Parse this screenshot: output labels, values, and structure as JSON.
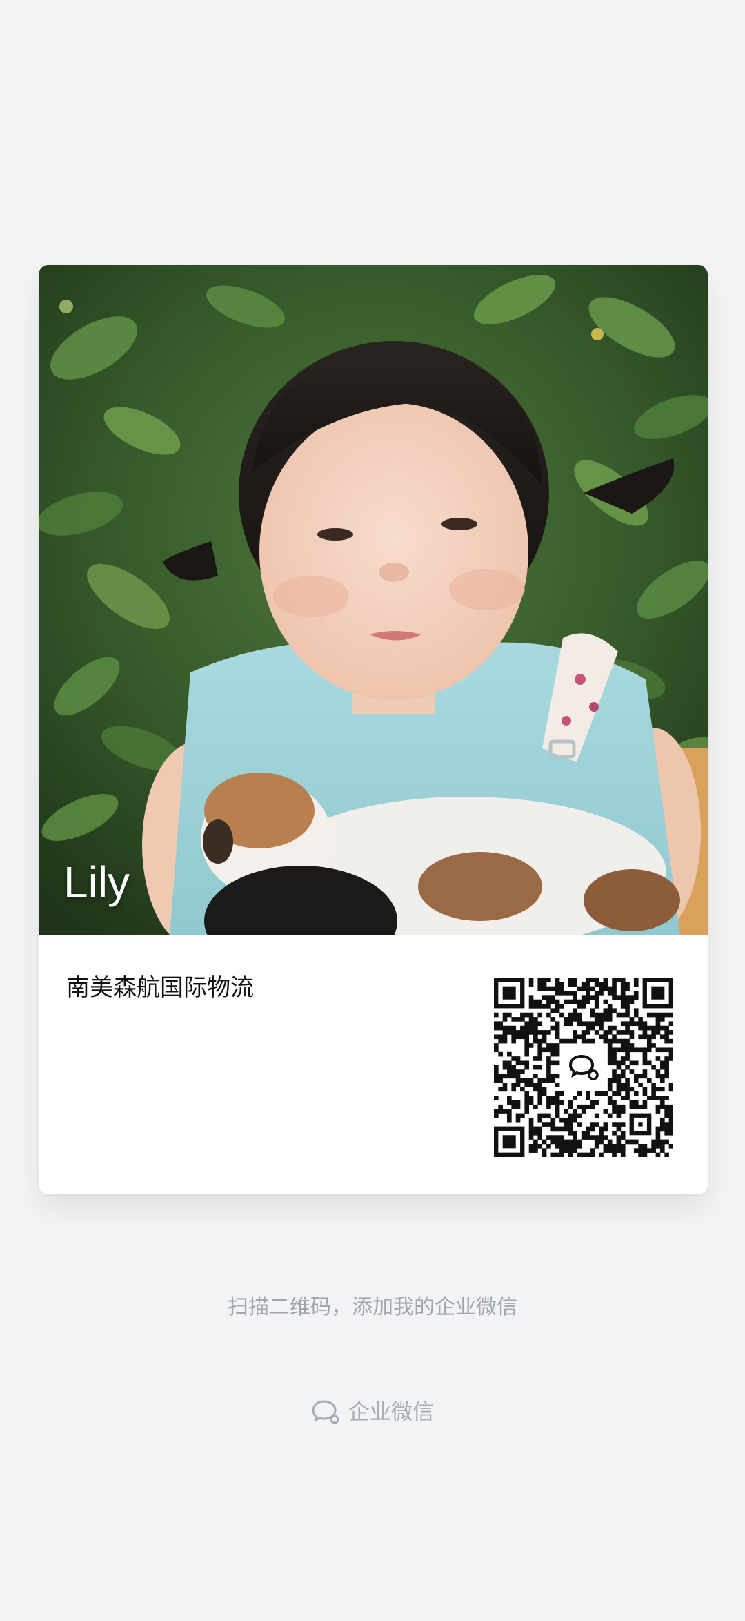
{
  "card": {
    "photo_name": "Lily",
    "company": "南美森航国际物流"
  },
  "qr": {
    "icon": "wecom-logo-icon"
  },
  "hint": "扫描二维码，添加我的企业微信",
  "brand": {
    "icon": "wecom-logo-icon",
    "label": "企业微信"
  }
}
